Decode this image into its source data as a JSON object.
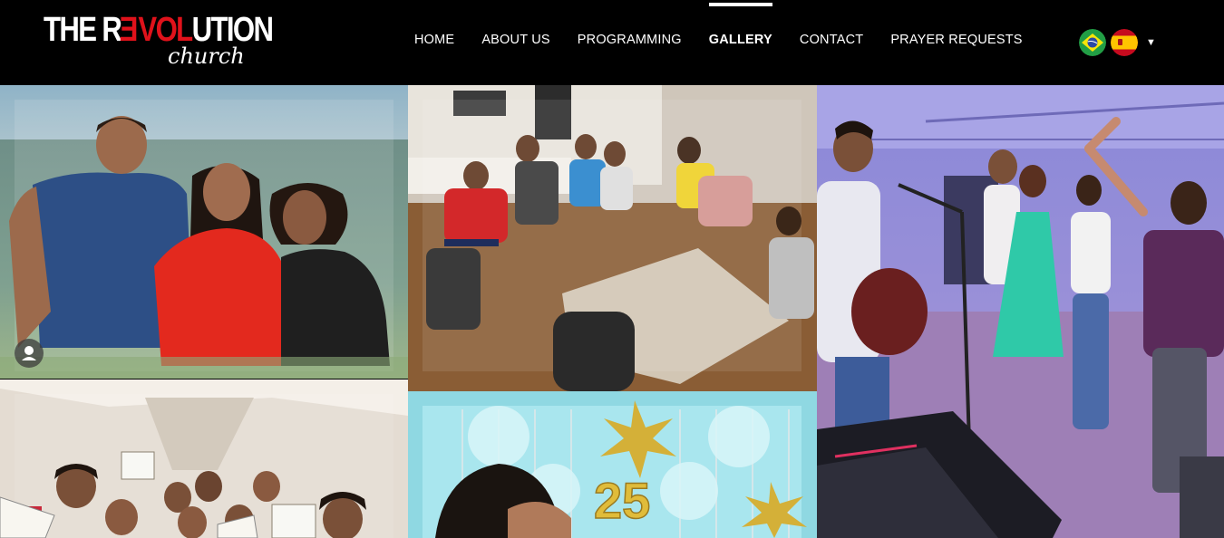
{
  "logo": {
    "line1_a": "THE R",
    "line1_b": "E",
    "line1_c": "VOL",
    "line1_d": "UTION",
    "line2": "church"
  },
  "nav": {
    "items": [
      {
        "label": "HOME"
      },
      {
        "label": "ABOUT US"
      },
      {
        "label": "PROGRAMMING"
      },
      {
        "label": "GALLERY"
      },
      {
        "label": "CONTACT"
      },
      {
        "label": "PRAYER REQUESTS"
      }
    ],
    "active": "GALLERY"
  },
  "language": {
    "flags": [
      "brazil-flag-icon",
      "spain-flag-icon"
    ]
  },
  "gallery": {
    "images": [
      {
        "subject": "baptism-in-ocean-photo"
      },
      {
        "subject": "living-room-worship-photo"
      },
      {
        "subject": "stage-worship-band-photo"
      },
      {
        "subject": "group-with-certificates-photo"
      },
      {
        "subject": "birthday-celebration-photo"
      }
    ],
    "birthday_number": "25"
  },
  "colors": {
    "header_bg": "#000000",
    "accent_red": "#e0121b",
    "text": "#ffffff"
  }
}
